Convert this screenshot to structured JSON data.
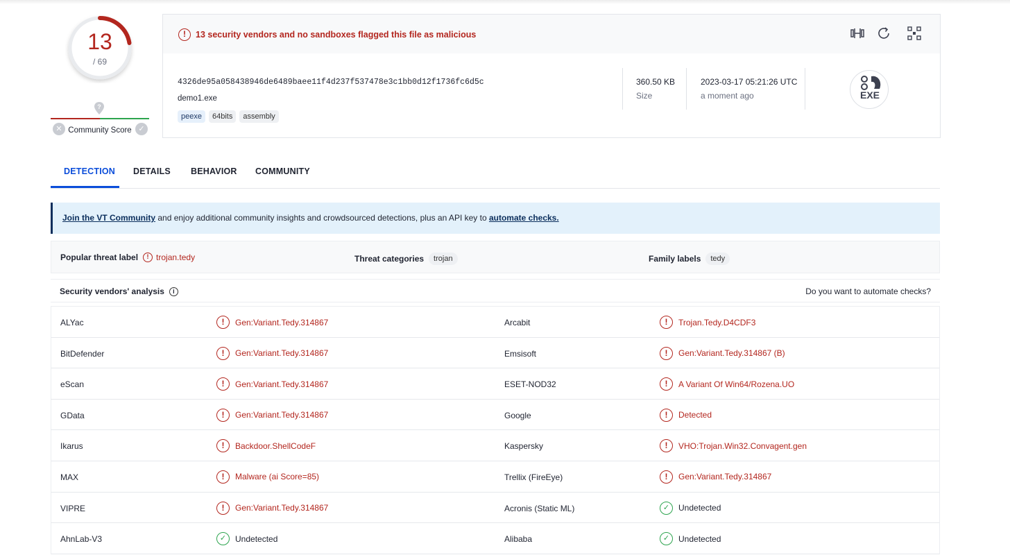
{
  "score": {
    "detections": "13",
    "total": "/ 69"
  },
  "community": {
    "label": "Community Score",
    "unknown_glyph": "?"
  },
  "alert": {
    "icon_glyph": "!",
    "text": "13 security vendors and no sandboxes flagged this file as malicious"
  },
  "file": {
    "hash": "4326de95a058438946de6489baee11f4d237f537478e3c1bb0d12f1736fc6d5c",
    "name": "demo1.exe",
    "tags": [
      "peexe",
      "64bits",
      "assembly"
    ],
    "size_value": "360.50 KB",
    "size_label": "Size",
    "date_value": "2023-03-17 05:21:26 UTC",
    "date_label": "a moment ago",
    "type_badge": "EXE"
  },
  "tabs": [
    "DETECTION",
    "DETAILS",
    "BEHAVIOR",
    "COMMUNITY"
  ],
  "info_banner": {
    "link1": "Join the VT Community",
    "middle": " and enjoy additional community insights and crowdsourced detections, plus an API key to ",
    "link2": "automate checks."
  },
  "threat": {
    "popular_label_key": "Popular threat label",
    "popular_label_value": "trojan.tedy",
    "categories_key": "Threat categories",
    "categories_value": "trojan",
    "family_key": "Family labels",
    "family_value": "tedy"
  },
  "vendors_header": {
    "title": "Security vendors' analysis",
    "right": "Do you want to automate checks?"
  },
  "vendors": [
    [
      {
        "name": "ALYac",
        "result": "Gen:Variant.Tedy.314867",
        "status": "malicious"
      },
      {
        "name": "Arcabit",
        "result": "Trojan.Tedy.D4CDF3",
        "status": "malicious"
      }
    ],
    [
      {
        "name": "BitDefender",
        "result": "Gen:Variant.Tedy.314867",
        "status": "malicious"
      },
      {
        "name": "Emsisoft",
        "result": "Gen:Variant.Tedy.314867 (B)",
        "status": "malicious"
      }
    ],
    [
      {
        "name": "eScan",
        "result": "Gen:Variant.Tedy.314867",
        "status": "malicious"
      },
      {
        "name": "ESET-NOD32",
        "result": "A Variant Of Win64/Rozena.UO",
        "status": "malicious"
      }
    ],
    [
      {
        "name": "GData",
        "result": "Gen:Variant.Tedy.314867",
        "status": "malicious"
      },
      {
        "name": "Google",
        "result": "Detected",
        "status": "malicious"
      }
    ],
    [
      {
        "name": "Ikarus",
        "result": "Backdoor.ShellCodeF",
        "status": "malicious"
      },
      {
        "name": "Kaspersky",
        "result": "VHO:Trojan.Win32.Convagent.gen",
        "status": "malicious"
      }
    ],
    [
      {
        "name": "MAX",
        "result": "Malware (ai Score=85)",
        "status": "malicious"
      },
      {
        "name": "Trellix (FireEye)",
        "result": "Gen:Variant.Tedy.314867",
        "status": "malicious"
      }
    ],
    [
      {
        "name": "VIPRE",
        "result": "Gen:Variant.Tedy.314867",
        "status": "malicious"
      },
      {
        "name": "Acronis (Static ML)",
        "result": "Undetected",
        "status": "undetected"
      }
    ],
    [
      {
        "name": "AhnLab-V3",
        "result": "Undetected",
        "status": "undetected"
      },
      {
        "name": "Alibaba",
        "result": "Undetected",
        "status": "undetected"
      }
    ]
  ],
  "colors": {
    "malicious": "#b3261e",
    "clean": "#2da44e",
    "active_tab": "#0b4dda",
    "banner_bg": "#e3f1fb"
  }
}
